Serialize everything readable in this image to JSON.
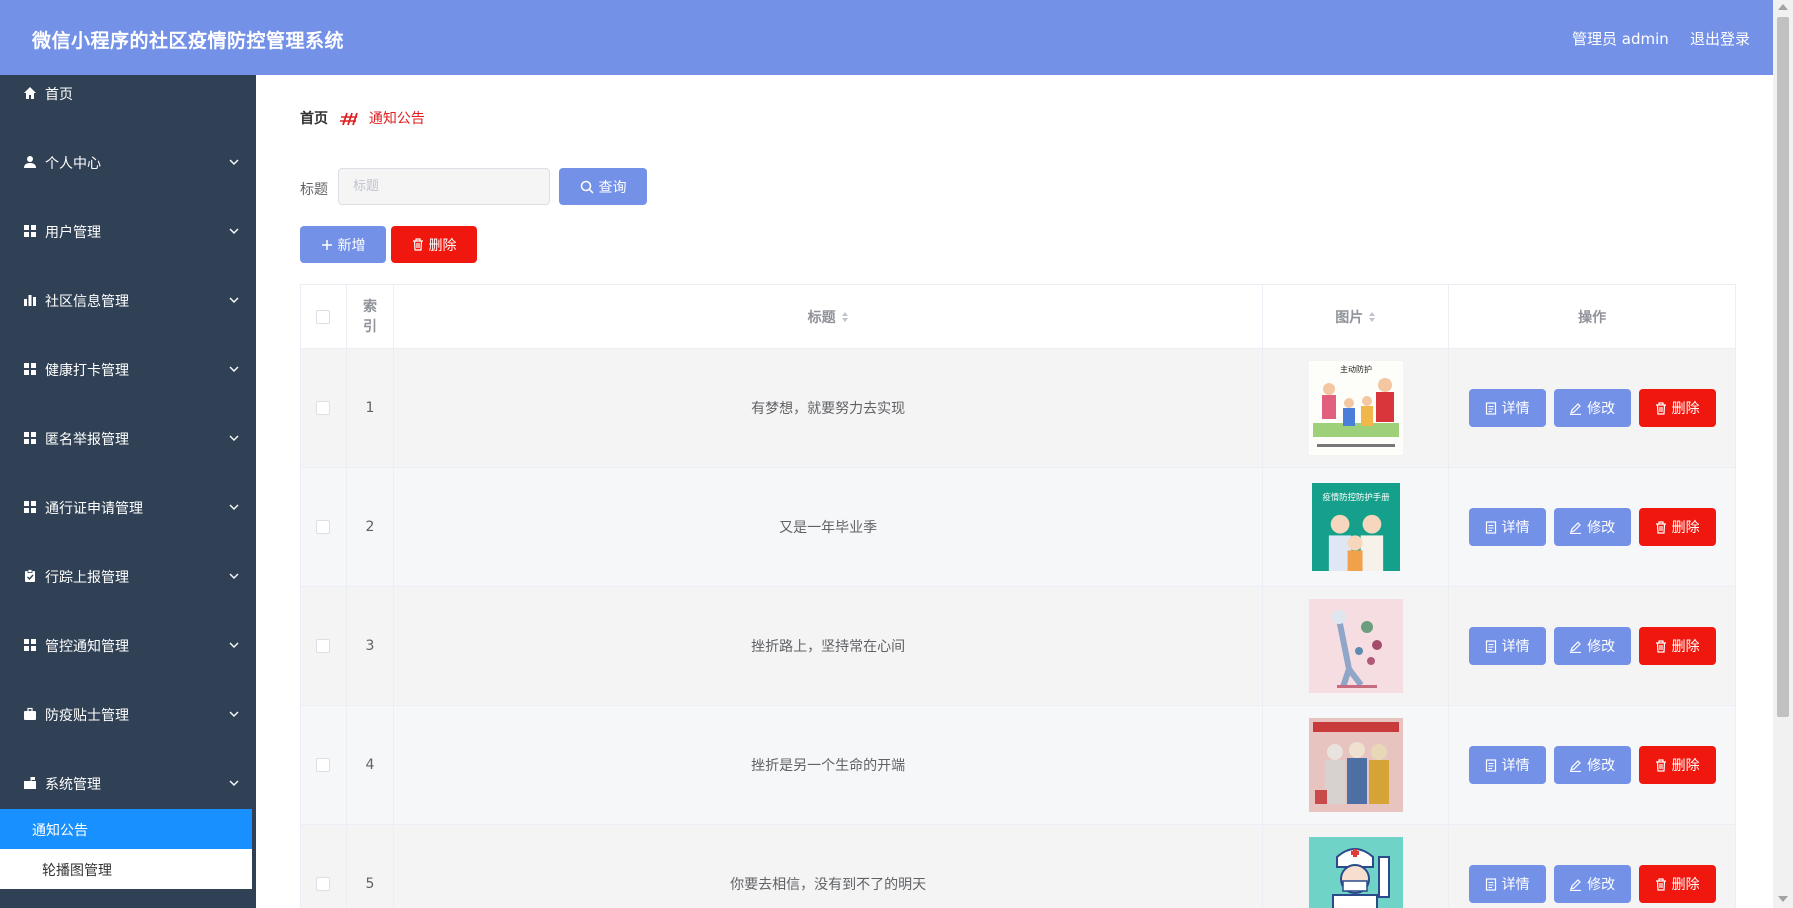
{
  "header": {
    "app_title": "微信小程序的社区疫情防控管理系统",
    "user_label": "管理员 admin",
    "logout_label": "退出登录"
  },
  "sidebar": {
    "items": [
      {
        "label": "首页",
        "icon": "home-icon",
        "has_chevron": false
      },
      {
        "label": "个人中心",
        "icon": "user-icon",
        "has_chevron": true
      },
      {
        "label": "用户管理",
        "icon": "grid-icon",
        "has_chevron": true
      },
      {
        "label": "社区信息管理",
        "icon": "bar-chart-icon",
        "has_chevron": true
      },
      {
        "label": "健康打卡管理",
        "icon": "grid-icon",
        "has_chevron": true
      },
      {
        "label": "匿名举报管理",
        "icon": "grid-icon",
        "has_chevron": true
      },
      {
        "label": "通行证申请管理",
        "icon": "grid-icon",
        "has_chevron": true
      },
      {
        "label": "行踪上报管理",
        "icon": "clipboard-icon",
        "has_chevron": true
      },
      {
        "label": "管控通知管理",
        "icon": "grid-icon",
        "has_chevron": true
      },
      {
        "label": "防疫贴士管理",
        "icon": "briefcase-icon",
        "has_chevron": true
      },
      {
        "label": "系统管理",
        "icon": "mailbox-icon",
        "has_chevron": true
      }
    ],
    "submenu": [
      {
        "label": "通知公告",
        "active": true
      },
      {
        "label": "轮播图管理",
        "active": false
      }
    ]
  },
  "breadcrumb": {
    "home": "首页",
    "current": "通知公告"
  },
  "search": {
    "label": "标题",
    "placeholder": "标题",
    "value": "",
    "button_label": "查询"
  },
  "actions": {
    "add_label": "新增",
    "delete_label": "删除"
  },
  "table": {
    "headers": {
      "index": "索引",
      "title": "标题",
      "image": "图片",
      "ops": "操作"
    },
    "op_labels": {
      "detail": "详情",
      "edit": "修改",
      "delete": "删除"
    },
    "rows": [
      {
        "index": "1",
        "title": "有梦想，就要努力去实现",
        "image_caption": "主动防护"
      },
      {
        "index": "2",
        "title": "又是一年毕业季",
        "image_caption": "疫情防控防护手册"
      },
      {
        "index": "3",
        "title": "挫折路上，坚持常在心间",
        "image_caption": ""
      },
      {
        "index": "4",
        "title": "挫折是另一个生命的开端",
        "image_caption": ""
      },
      {
        "index": "5",
        "title": "你要去相信，没有到不了的明天",
        "image_caption": ""
      }
    ]
  },
  "colors": {
    "header_bg": "#7491e8",
    "sidebar_bg": "#304156",
    "active_menu": "#1890ff",
    "danger": "#f0180e",
    "primary": "#7491e8"
  }
}
